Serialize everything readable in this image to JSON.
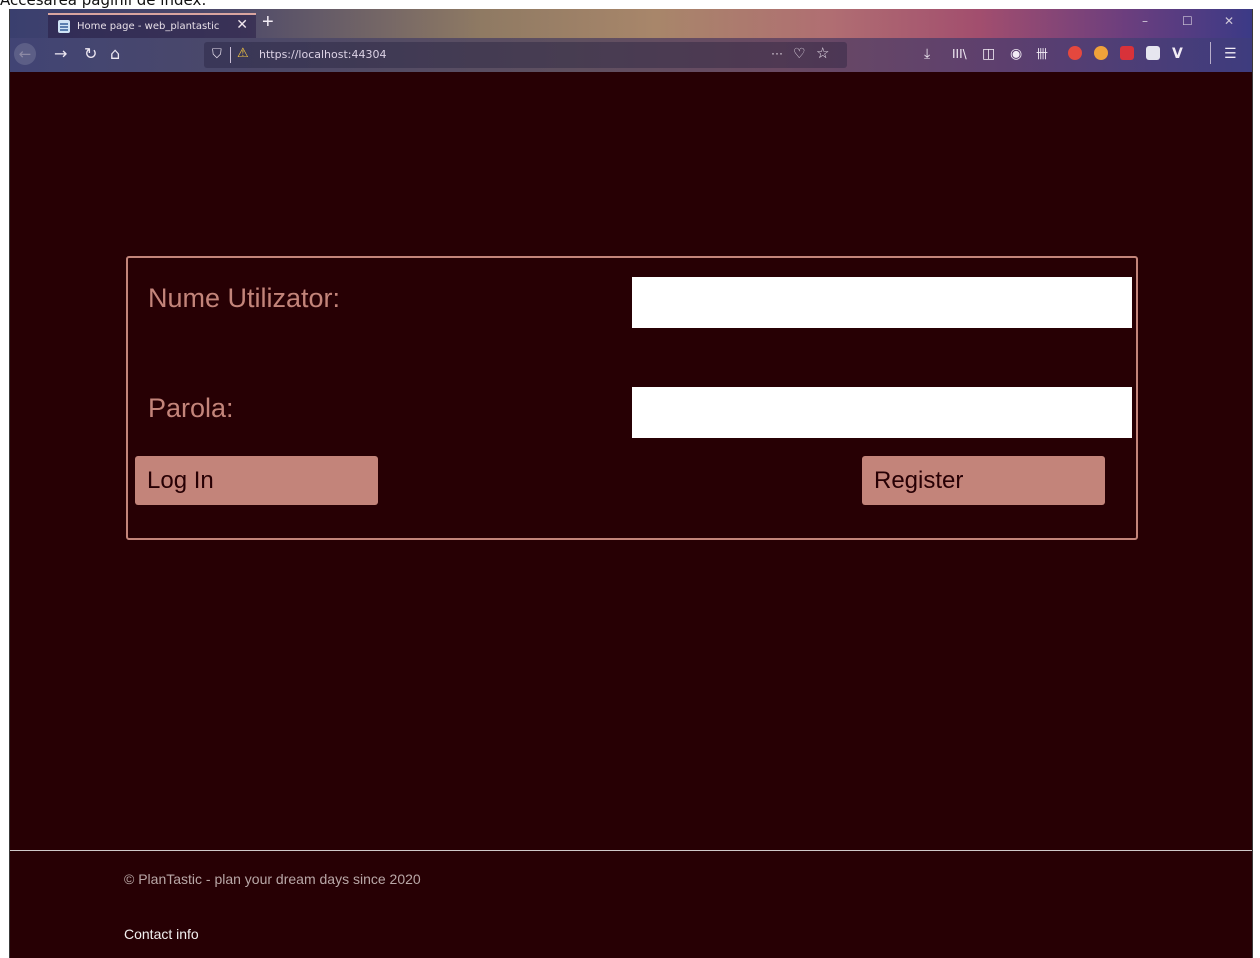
{
  "caption": "Accesarea paginii de index:",
  "browser": {
    "tab_title": "Home page - web_plantastic",
    "tab_close": "✕",
    "new_tab": "+",
    "url": "https://localhost:44304",
    "page_actions": "···",
    "window_controls": {
      "minimize": "–",
      "maximize": "☐",
      "close": "✕"
    },
    "toolbar_icons": [
      "download-icon",
      "library-icon",
      "sidebar-icon",
      "account-icon",
      "extension-icon",
      "extension-icon",
      "extension-icon",
      "extension-icon",
      "extension-icon",
      "vivaldi-icon",
      "menu-icon"
    ]
  },
  "login": {
    "username_label": "Nume Utilizator:",
    "username_value": "",
    "password_label": "Parola:",
    "password_value": "",
    "login_button": "Log In",
    "register_button": "Register"
  },
  "footer": {
    "copyright": "© PlanTastic - plan your dream days since 2020",
    "contact": "Contact info"
  },
  "colors": {
    "background": "#270004",
    "accent": "#c3847a",
    "input_bg": "#ffffff"
  }
}
